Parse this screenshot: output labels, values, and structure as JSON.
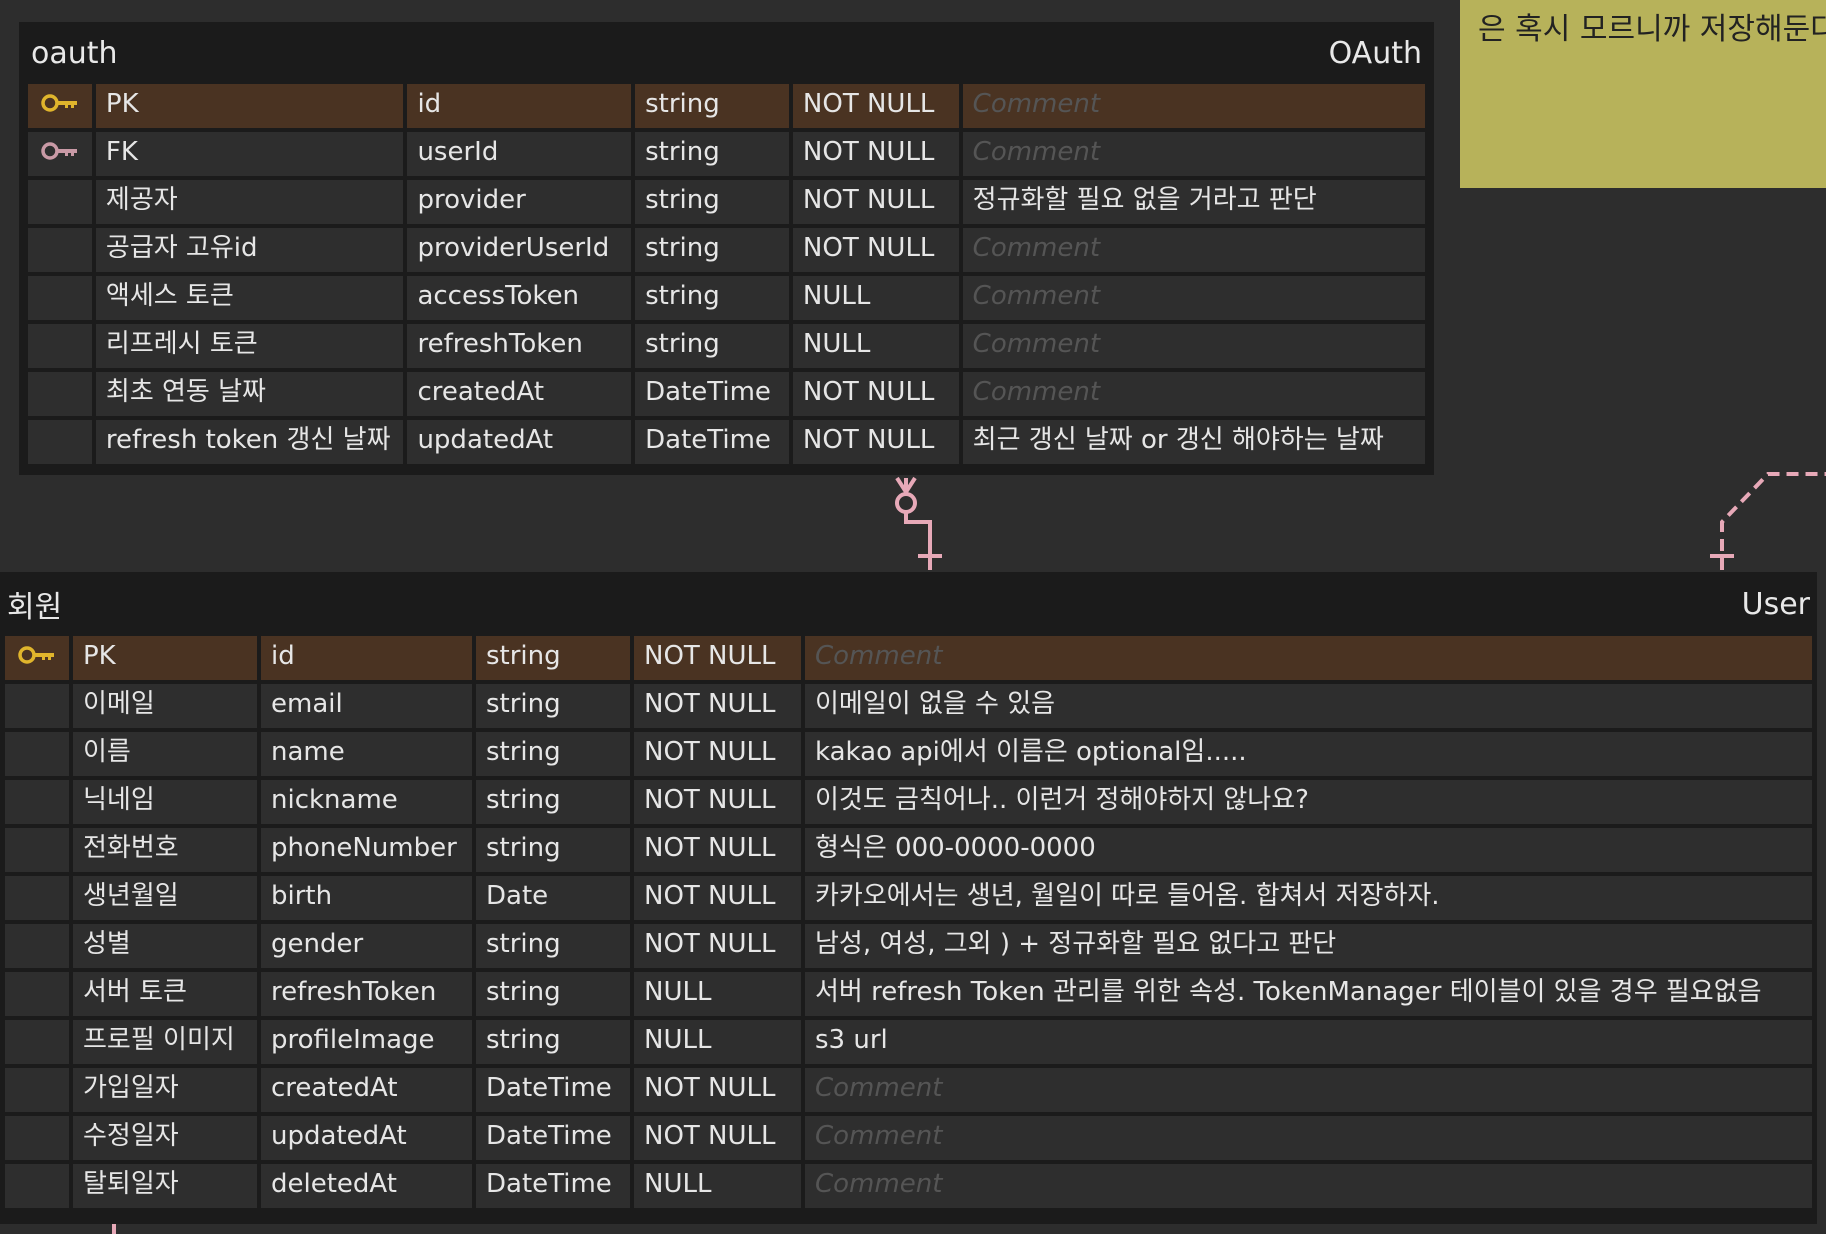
{
  "memo": {
    "text": "은 혹시 모르니까 저장해둔다"
  },
  "tables": [
    {
      "logical_name": "oauth",
      "physical_name": "OAuth",
      "rows": [
        {
          "key": "PK",
          "logical": "PK",
          "physical": "id",
          "type": "string",
          "nullable": "NOT NULL",
          "comment": "Comment",
          "comment_is_placeholder": true
        },
        {
          "key": "FK",
          "logical": "FK",
          "physical": "userId",
          "type": "string",
          "nullable": "NOT NULL",
          "comment": "Comment",
          "comment_is_placeholder": true
        },
        {
          "key": "",
          "logical": "제공자",
          "physical": "provider",
          "type": "string",
          "nullable": "NOT NULL",
          "comment": "정규화할 필요 없을 거라고 판단",
          "comment_is_placeholder": false
        },
        {
          "key": "",
          "logical": "공급자 고유id",
          "physical": "providerUserId",
          "type": "string",
          "nullable": "NOT NULL",
          "comment": "Comment",
          "comment_is_placeholder": true
        },
        {
          "key": "",
          "logical": "액세스 토큰",
          "physical": "accessToken",
          "type": "string",
          "nullable": "NULL",
          "comment": "Comment",
          "comment_is_placeholder": true
        },
        {
          "key": "",
          "logical": "리프레시 토큰",
          "physical": "refreshToken",
          "type": "string",
          "nullable": "NULL",
          "comment": "Comment",
          "comment_is_placeholder": true
        },
        {
          "key": "",
          "logical": "최초 연동 날짜",
          "physical": "createdAt",
          "type": "DateTime",
          "nullable": "NOT NULL",
          "comment": "Comment",
          "comment_is_placeholder": true
        },
        {
          "key": "",
          "logical": "refresh token 갱신 날짜",
          "physical": "updatedAt",
          "type": "DateTime",
          "nullable": "NOT NULL",
          "comment": "최근 갱신 날짜 or 갱신 해야하는 날짜",
          "comment_is_placeholder": false
        }
      ]
    },
    {
      "logical_name": "회원",
      "physical_name": "User",
      "rows": [
        {
          "key": "PK",
          "logical": "PK",
          "physical": "id",
          "type": "string",
          "nullable": "NOT NULL",
          "comment": "Comment",
          "comment_is_placeholder": true
        },
        {
          "key": "",
          "logical": "이메일",
          "physical": "email",
          "type": "string",
          "nullable": "NOT NULL",
          "comment": "이메일이 없을 수 있음",
          "comment_is_placeholder": false
        },
        {
          "key": "",
          "logical": "이름",
          "physical": "name",
          "type": "string",
          "nullable": "NOT NULL",
          "comment": "kakao api에서 이름은 optional임.....",
          "comment_is_placeholder": false
        },
        {
          "key": "",
          "logical": "닉네임",
          "physical": "nickname",
          "type": "string",
          "nullable": "NOT NULL",
          "comment": "이것도 금칙어나.. 이런거 정해야하지 않나요?",
          "comment_is_placeholder": false
        },
        {
          "key": "",
          "logical": "전화번호",
          "physical": "phoneNumber",
          "type": "string",
          "nullable": "NOT NULL",
          "comment": "형식은 000-0000-0000",
          "comment_is_placeholder": false
        },
        {
          "key": "",
          "logical": "생년월일",
          "physical": "birth",
          "type": "Date",
          "nullable": "NOT NULL",
          "comment": "카카오에서는 생년, 월일이 따로 들어옴. 합쳐서 저장하자.",
          "comment_is_placeholder": false
        },
        {
          "key": "",
          "logical": "성별",
          "physical": "gender",
          "type": "string",
          "nullable": "NOT NULL",
          "comment": "남성, 여성, 그외 ) + 정규화할 필요 없다고 판단",
          "comment_is_placeholder": false
        },
        {
          "key": "",
          "logical": "서버 토큰",
          "physical": "refreshToken",
          "type": "string",
          "nullable": "NULL",
          "comment": "서버 refresh Token 관리를 위한 속성.  TokenManager 테이블이 있을 경우 필요없음",
          "comment_is_placeholder": false
        },
        {
          "key": "",
          "logical": "프로필 이미지",
          "physical": "profileImage",
          "type": "string",
          "nullable": "NULL",
          "comment": "s3 url",
          "comment_is_placeholder": false
        },
        {
          "key": "",
          "logical": "가입일자",
          "physical": "createdAt",
          "type": "DateTime",
          "nullable": "NOT NULL",
          "comment": "Comment",
          "comment_is_placeholder": true
        },
        {
          "key": "",
          "logical": "수정일자",
          "physical": "updatedAt",
          "type": "DateTime",
          "nullable": "NOT NULL",
          "comment": "Comment",
          "comment_is_placeholder": true
        },
        {
          "key": "",
          "logical": "탈퇴일자",
          "physical": "deletedAt",
          "type": "DateTime",
          "nullable": "NULL",
          "comment": "Comment",
          "comment_is_placeholder": true
        }
      ]
    }
  ],
  "colors": {
    "canvas": "#2d2d2d",
    "table_bg": "#1b1b1b",
    "cell_bg": "#2e2e2e",
    "pk_row_bg": "#4a3322",
    "pk_key_icon": "#e0b52c",
    "fk_key_icon": "#c99aa6",
    "relation_line": "#e7a9b8",
    "memo_bg": "#b7b25a"
  },
  "icons": {
    "pk": "key-icon",
    "fk": "key-icon"
  }
}
